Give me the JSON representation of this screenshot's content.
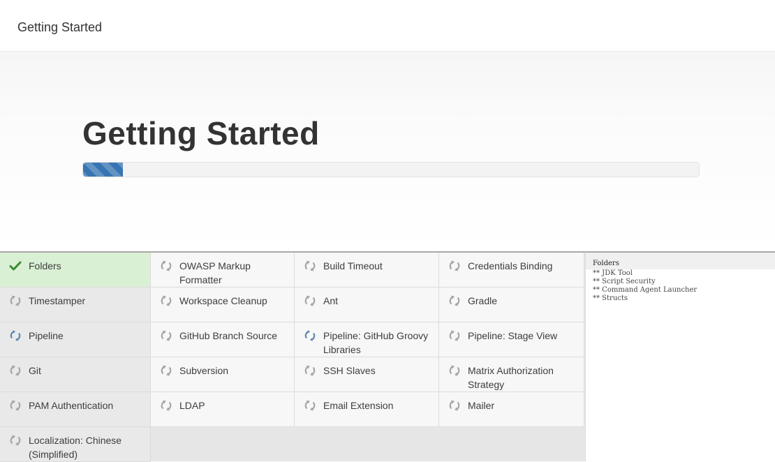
{
  "header": {
    "title": "Getting Started"
  },
  "hero": {
    "heading": "Getting Started",
    "progress_percent": 6.5
  },
  "plugins": [
    {
      "label": "Folders",
      "state": "done"
    },
    {
      "label": "OWASP Markup Formatter",
      "state": "pending"
    },
    {
      "label": "Build Timeout",
      "state": "pending"
    },
    {
      "label": "Credentials Binding",
      "state": "pending"
    },
    {
      "label": "Timestamper",
      "state": "pending"
    },
    {
      "label": "Workspace Cleanup",
      "state": "pending"
    },
    {
      "label": "Ant",
      "state": "pending"
    },
    {
      "label": "Gradle",
      "state": "pending"
    },
    {
      "label": "Pipeline",
      "state": "installing"
    },
    {
      "label": "GitHub Branch Source",
      "state": "pending"
    },
    {
      "label": "Pipeline: GitHub Groovy Libraries",
      "state": "installing"
    },
    {
      "label": "Pipeline: Stage View",
      "state": "pending"
    },
    {
      "label": "Git",
      "state": "pending"
    },
    {
      "label": "Subversion",
      "state": "pending"
    },
    {
      "label": "SSH Slaves",
      "state": "pending"
    },
    {
      "label": "Matrix Authorization Strategy",
      "state": "pending"
    },
    {
      "label": "PAM Authentication",
      "state": "pending"
    },
    {
      "label": "LDAP",
      "state": "pending"
    },
    {
      "label": "Email Extension",
      "state": "pending"
    },
    {
      "label": "Mailer",
      "state": "pending"
    },
    {
      "label": "Localization: Chinese (Simplified)",
      "state": "pending"
    }
  ],
  "log": {
    "title": "Folders",
    "lines": [
      "** JDK Tool",
      "** Script Security",
      "** Command Agent Launcher",
      "** Structs"
    ]
  },
  "icons": {
    "done": "checkmark-icon",
    "pending": "refresh-icon",
    "installing": "sync-arrows-icon"
  },
  "colors": {
    "progress_fill": "#3774b2",
    "done_bg": "#d9f0d4",
    "check": "#3a8a35",
    "pending_icon": "#a6a6a6",
    "installing_icon": "#5a87b0"
  }
}
